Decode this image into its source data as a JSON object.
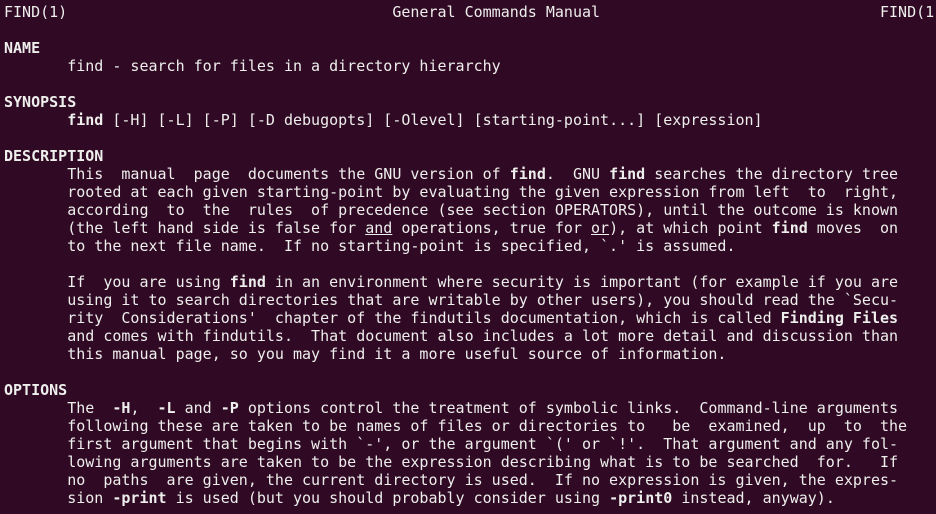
{
  "header": {
    "left": "FIND(1)",
    "center": "General Commands Manual",
    "right": "FIND(1)"
  },
  "lines": [
    [
      {
        "t": "FIND(1)                                    General Commands Manual                               FIND(1)"
      }
    ],
    [
      {
        "t": ""
      }
    ],
    [
      {
        "t": "NAME",
        "b": true
      }
    ],
    [
      {
        "t": "       find - search for files in a directory hierarchy"
      }
    ],
    [
      {
        "t": ""
      }
    ],
    [
      {
        "t": "SYNOPSIS",
        "b": true
      }
    ],
    [
      {
        "t": "       "
      },
      {
        "t": "find",
        "b": true
      },
      {
        "t": " [-H] [-L] [-P] [-D debugopts] [-Olevel] [starting-point...] [expression]"
      }
    ],
    [
      {
        "t": ""
      }
    ],
    [
      {
        "t": "DESCRIPTION",
        "b": true
      }
    ],
    [
      {
        "t": "       This  manual  page  documents the GNU version of "
      },
      {
        "t": "find",
        "b": true
      },
      {
        "t": ".  GNU "
      },
      {
        "t": "find",
        "b": true
      },
      {
        "t": " searches the directory tree"
      }
    ],
    [
      {
        "t": "       rooted at each given starting-point by evaluating the given expression from left  to  right,"
      }
    ],
    [
      {
        "t": "       according  to  the  rules  of precedence (see section OPERATORS), until the outcome is known"
      }
    ],
    [
      {
        "t": "       (the left hand side is false for "
      },
      {
        "t": "and",
        "u": true
      },
      {
        "t": " operations, true for "
      },
      {
        "t": "or",
        "u": true
      },
      {
        "t": "), at which point "
      },
      {
        "t": "find",
        "b": true
      },
      {
        "t": " moves  on"
      }
    ],
    [
      {
        "t": "       to the next file name.  If no starting-point is specified, `.' is assumed."
      }
    ],
    [
      {
        "t": ""
      }
    ],
    [
      {
        "t": "       If  you are using "
      },
      {
        "t": "find",
        "b": true
      },
      {
        "t": " in an environment where security is important (for example if you are"
      }
    ],
    [
      {
        "t": "       using it to search directories that are writable by other users), you should read the `Secu-"
      }
    ],
    [
      {
        "t": "       rity  Considerations'  chapter of the findutils documentation, which is called "
      },
      {
        "t": "Finding Files",
        "b": true
      }
    ],
    [
      {
        "t": "       and comes with findutils.  That document also includes a lot more detail and discussion than"
      }
    ],
    [
      {
        "t": "       this manual page, so you may find it a more useful source of information."
      }
    ],
    [
      {
        "t": ""
      }
    ],
    [
      {
        "t": "OPTIONS",
        "b": true
      }
    ],
    [
      {
        "t": "       The  "
      },
      {
        "t": "-H",
        "b": true
      },
      {
        "t": ",  "
      },
      {
        "t": "-L",
        "b": true
      },
      {
        "t": " and "
      },
      {
        "t": "-P",
        "b": true
      },
      {
        "t": " options control the treatment of symbolic links.  Command-line arguments"
      }
    ],
    [
      {
        "t": "       following these are taken to be names of files or directories to   be  examined,  up  to  the"
      }
    ],
    [
      {
        "t": "       first argument that begins with `-', or the argument `(' or `!'.  That argument and any fol-"
      }
    ],
    [
      {
        "t": "       lowing arguments are taken to be the expression describing what is to be searched  for.   If"
      }
    ],
    [
      {
        "t": "       no  paths  are given, the current directory is used.  If no expression is given, the expres-"
      }
    ],
    [
      {
        "t": "       sion "
      },
      {
        "t": "-print",
        "b": true
      },
      {
        "t": " is used (but you should probably consider using "
      },
      {
        "t": "-print0",
        "b": true
      },
      {
        "t": " instead, anyway)."
      }
    ]
  ]
}
